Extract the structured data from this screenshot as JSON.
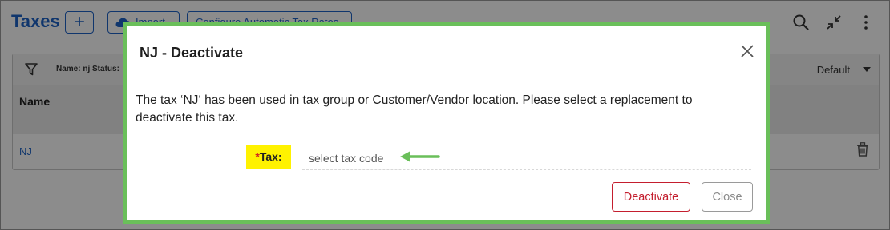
{
  "page": {
    "title": "Taxes",
    "add_label": "+",
    "import_label": "Import",
    "config_label": "Configure Automatic Tax Rates",
    "filter_text": "Name: nj Status:",
    "view_label": "Default",
    "column_name": "Name",
    "rows": [
      {
        "name": "NJ"
      }
    ]
  },
  "modal": {
    "title": "NJ - Deactivate",
    "message": "The tax ‘NJ‘ has been used in tax group or Customer/Vendor location. Please select a replacement to deactivate this tax.",
    "tax_label_required": "*",
    "tax_label": "Tax:",
    "tax_placeholder": "select tax code",
    "deactivate_label": "Deactivate",
    "close_label": "Close"
  },
  "colors": {
    "accent": "#1e63c6",
    "modal_highlight_border": "#6abf5a",
    "danger": "#c41e2e",
    "annotation_highlight": "#fff200",
    "annotation_arrow": "#6abf5a"
  },
  "icons": [
    "cloud-icon",
    "search-icon",
    "collapse-icon",
    "more-vertical-icon",
    "filter-icon",
    "caret-down-icon",
    "trash-icon",
    "close-icon",
    "arrow-left-icon"
  ]
}
